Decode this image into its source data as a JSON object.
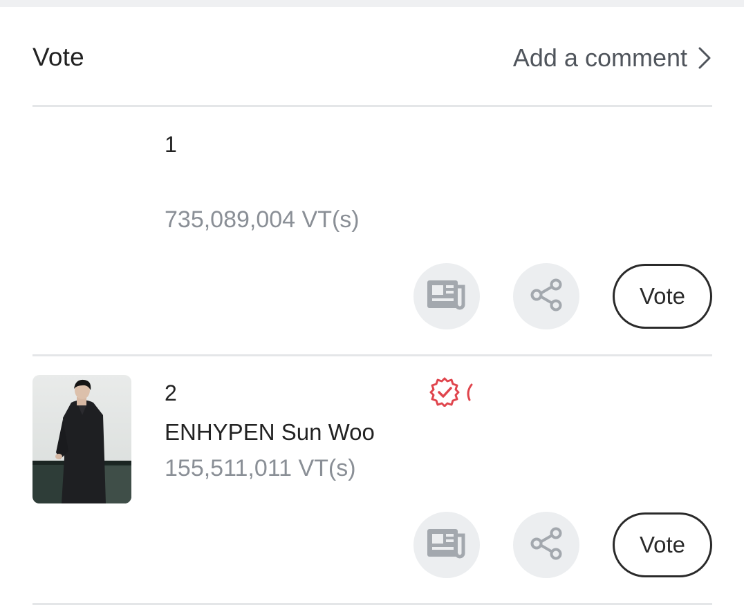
{
  "header": {
    "title": "Vote",
    "comment_label": "Add a comment"
  },
  "entries": [
    {
      "rank": "1",
      "name": "",
      "votes": "735,089,004 VT(s)",
      "vote_label": "Vote"
    },
    {
      "rank": "2",
      "name": "ENHYPEN Sun Woo",
      "votes": "155,511,011 VT(s)",
      "vote_label": "Vote",
      "badge_icon": "verified-badge-icon"
    }
  ],
  "colors": {
    "muted_text": "#8a8f96",
    "button_bg": "#eceef0",
    "icon_gray": "#a3a8ae",
    "badge_red": "#e0454d",
    "divider": "#e4e6e8"
  }
}
